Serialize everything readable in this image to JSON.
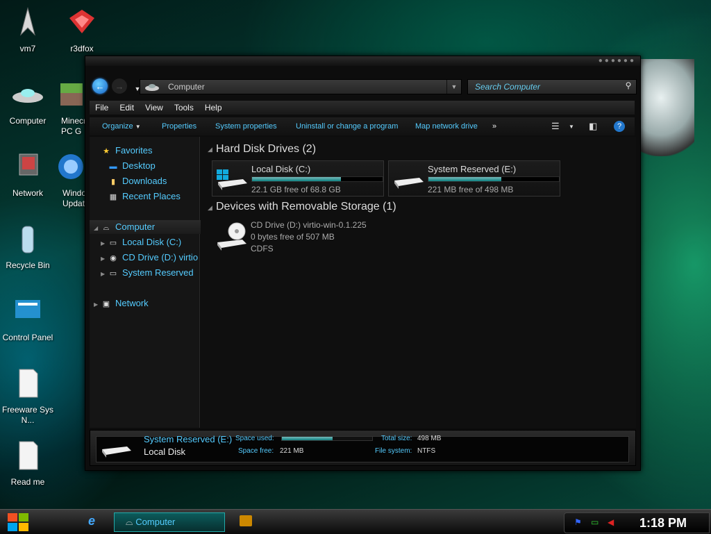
{
  "desktop": {
    "icons": [
      {
        "label": "vm7"
      },
      {
        "label": "r3dfox"
      },
      {
        "label": "Computer"
      },
      {
        "label": "Minecraft PC G"
      },
      {
        "label": "Network"
      },
      {
        "label": "Windows Update"
      },
      {
        "label": "Recycle Bin"
      },
      {
        "label": "Control Panel"
      },
      {
        "label": "Freeware Sys N..."
      },
      {
        "label": "Read me"
      }
    ]
  },
  "window": {
    "address": "Computer",
    "search_placeholder": "Search Computer",
    "menu": [
      "File",
      "Edit",
      "View",
      "Tools",
      "Help"
    ],
    "commands": [
      "Organize",
      "Properties",
      "System properties",
      "Uninstall or change a program",
      "Map network drive",
      "»"
    ],
    "nav": {
      "favorites": "Favorites",
      "desktop": "Desktop",
      "downloads": "Downloads",
      "recent": "Recent Places",
      "computer": "Computer",
      "local_disk": "Local Disk (C:)",
      "cd_drive": "CD Drive (D:) virtio",
      "system_reserved": "System Reserved",
      "network": "Network"
    },
    "content": {
      "hdd_header": "Hard Disk Drives (2)",
      "removable_header": "Devices with Removable Storage (1)",
      "drives": [
        {
          "name": "Local Disk (C:)",
          "free": "22.1 GB free of 68.8 GB",
          "used_fraction": 0.68
        },
        {
          "name": "System Reserved (E:)",
          "free": "221 MB free of 498 MB",
          "used_fraction": 0.56
        }
      ],
      "cd": {
        "name": "CD Drive (D:) virtio-win-0.1.225",
        "free": "0 bytes free of 507 MB",
        "fs": "CDFS"
      }
    },
    "details": {
      "name": "System Reserved (E:)",
      "type": "Local Disk",
      "space_used_label": "Space used:",
      "space_free_label": "Space free:",
      "space_free": "221 MB",
      "total_size_label": "Total size:",
      "total_size": "498 MB",
      "fs_label": "File system:",
      "fs": "NTFS",
      "used_fraction": 0.56
    }
  },
  "taskbar": {
    "active_item": "Computer",
    "clock": "1:18 PM"
  },
  "colors": {
    "accent": "#55ccff",
    "window_bg": "#0d0d0d"
  }
}
